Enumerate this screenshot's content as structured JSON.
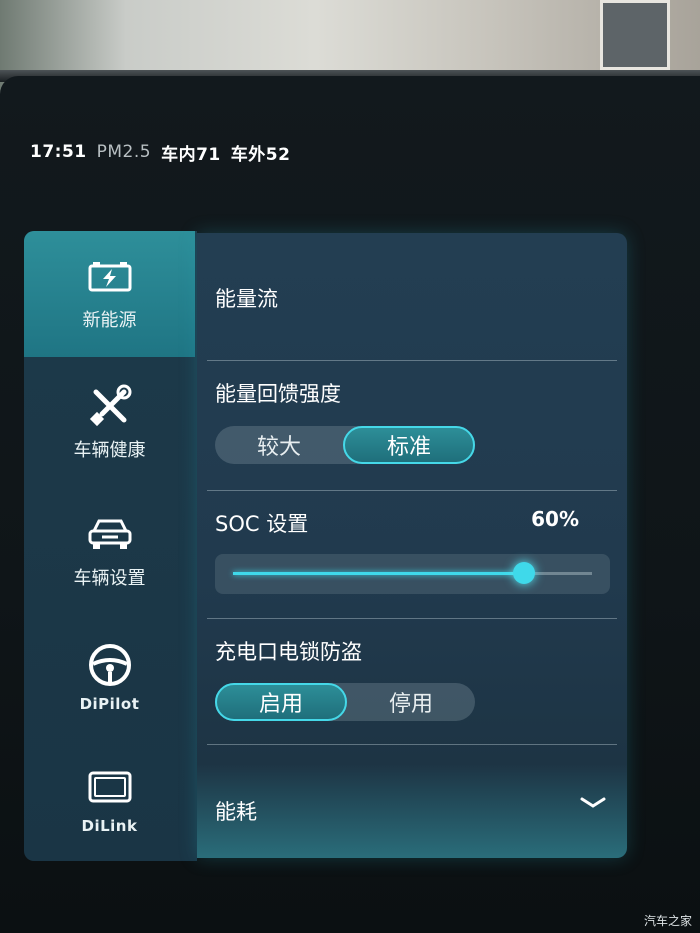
{
  "status_bar": {
    "time": "17:51",
    "pm25_label": "PM2.5",
    "inside_label": "车内",
    "inside_value": "71",
    "outside_label": "车外",
    "outside_value": "52"
  },
  "sidebar": {
    "items": [
      {
        "label": "新能源",
        "icon": "battery-bolt-icon",
        "active": true
      },
      {
        "label": "车辆健康",
        "icon": "tools-icon",
        "active": false
      },
      {
        "label": "车辆设置",
        "icon": "car-icon",
        "active": false
      },
      {
        "label": "DiPilot",
        "icon": "steering-wheel-icon",
        "active": false
      },
      {
        "label": "DiLink",
        "icon": "screen-icon",
        "active": false
      }
    ]
  },
  "main": {
    "energy_flow_title": "能量流",
    "regen": {
      "title": "能量回馈强度",
      "options": [
        "较大",
        "标准"
      ],
      "selected": "标准"
    },
    "soc": {
      "title": "SOC 设置",
      "value_label": "60%",
      "slider_fraction": 0.81
    },
    "charge_lock": {
      "title": "充电口电锁防盗",
      "options": [
        "启用",
        "停用"
      ],
      "selected": "启用"
    },
    "consumption_title": "能耗"
  },
  "watermark": "汽车之家",
  "colors": {
    "accent": "#3fd9ea",
    "active_tab": "#2e8f9a",
    "panel_bg": "#233e52"
  }
}
